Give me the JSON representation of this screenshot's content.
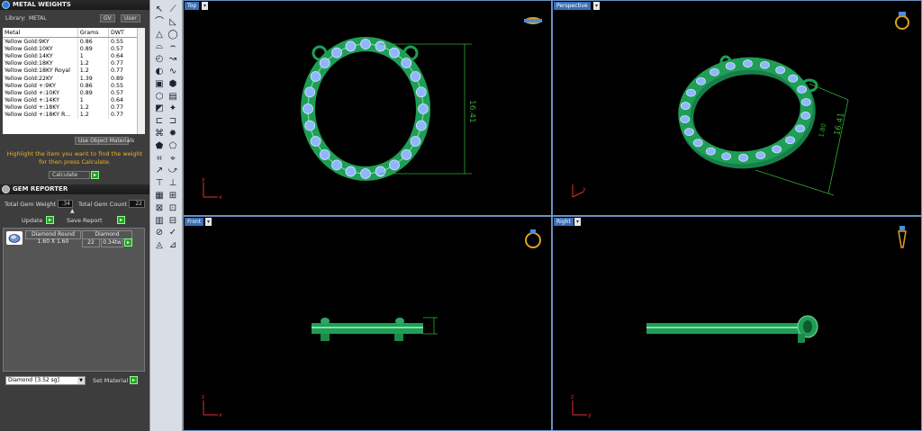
{
  "metal_panel": {
    "title": "METAL WEIGHTS",
    "library_label": "Library:",
    "library_value": "METAL",
    "btn_gv": "GV",
    "btn_user": "User",
    "columns": [
      "Metal",
      "Grams",
      "DWT"
    ],
    "rows": [
      [
        "Yellow Gold:9KY",
        "0.86",
        "0.55"
      ],
      [
        "Yellow Gold:10KY",
        "0.89",
        "0.57"
      ],
      [
        "Yellow Gold:14KY",
        "1",
        "0.64"
      ],
      [
        "Yellow Gold:18KY",
        "1.2",
        "0.77"
      ],
      [
        "Yellow Gold:18KY Royal",
        "1.2",
        "0.77"
      ],
      [
        "Yellow Gold:22KY",
        "1.39",
        "0.89"
      ],
      [
        "Yellow Gold +:9KY",
        "0.86",
        "0.55"
      ],
      [
        "Yellow Gold +:10KY",
        "0.89",
        "0.57"
      ],
      [
        "Yellow Gold +:14KY",
        "1",
        "0.64"
      ],
      [
        "Yellow Gold +:18KY",
        "1.2",
        "0.77"
      ],
      [
        "Yellow Gold +:18KY R...",
        "1.2",
        "0.77"
      ]
    ],
    "use_object_materials": "Use Object Materials",
    "instruction": "Highlight the item you want to find the weight for then press Calculate.",
    "calculate": "Calculate"
  },
  "gem_panel": {
    "title": "GEM REPORTER",
    "total_gem_weight_label": "Total Gem Weight",
    "total_gem_weight": ".34",
    "total_gem_count_label": "Total Gem Count",
    "total_gem_count": "22",
    "update": "Update",
    "save_report": "Save Report",
    "gem": {
      "shape": "Diamond Round",
      "size": "1.60 X 1.60",
      "type": "Diamond",
      "count": "22",
      "weight": "0.34tw"
    },
    "material_select": "Diamond",
    "material_sg": "[3.52 sg]",
    "set_material": "Set Material"
  },
  "viewports": {
    "top": {
      "label": "Top",
      "dimension": "16.41"
    },
    "perspective": {
      "label": "Perspective",
      "dimension": "16.41",
      "dimension_small": "1.80"
    },
    "front": {
      "label": "Front"
    },
    "right": {
      "label": "Right"
    }
  },
  "colors": {
    "accent": "#3a6fb5",
    "model_green": "#1f9e55",
    "gem_blue": "#8fb6ff",
    "dim_green": "#33aa33"
  }
}
